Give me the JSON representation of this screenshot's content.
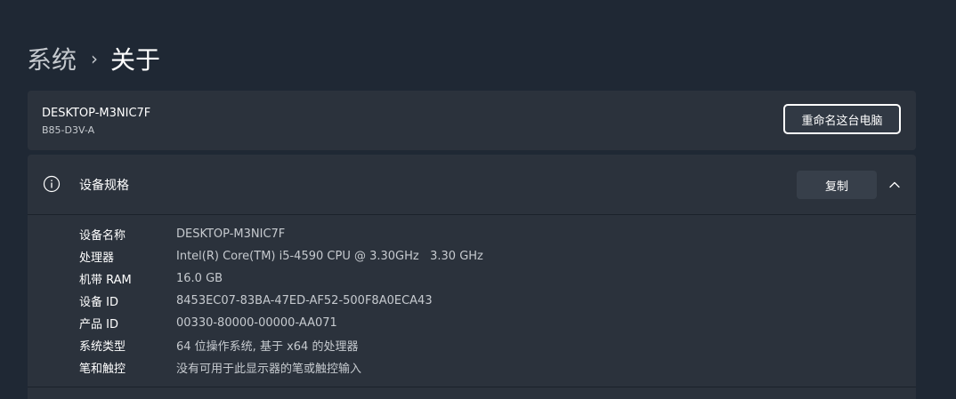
{
  "breadcrumb": {
    "parent": "系统",
    "separator": "›",
    "current": "关于"
  },
  "device": {
    "name": "DESKTOP-M3NIC7F",
    "model": "B85-D3V-A",
    "rename_label": "重命名这台电脑"
  },
  "specs": {
    "title": "设备规格",
    "icon": "info-icon",
    "copy_label": "复制",
    "expand_icon": "chevron-up-icon",
    "rows": [
      {
        "label": "设备名称",
        "value": "DESKTOP-M3NIC7F"
      },
      {
        "label": "处理器",
        "value": "Intel(R) Core(TM) i5-4590 CPU @ 3.30GHz   3.30 GHz"
      },
      {
        "label": "机带 RAM",
        "value": "16.0 GB"
      },
      {
        "label": "设备 ID",
        "value": "8453EC07-83BA-47ED-AF52-500F8A0ECA43"
      },
      {
        "label": "产品 ID",
        "value": "00330-80000-00000-AA071"
      },
      {
        "label": "系统类型",
        "value": "64 位操作系统, 基于 x64 的处理器"
      },
      {
        "label": "笔和触控",
        "value": "没有可用于此显示器的笔或触控输入"
      }
    ]
  }
}
